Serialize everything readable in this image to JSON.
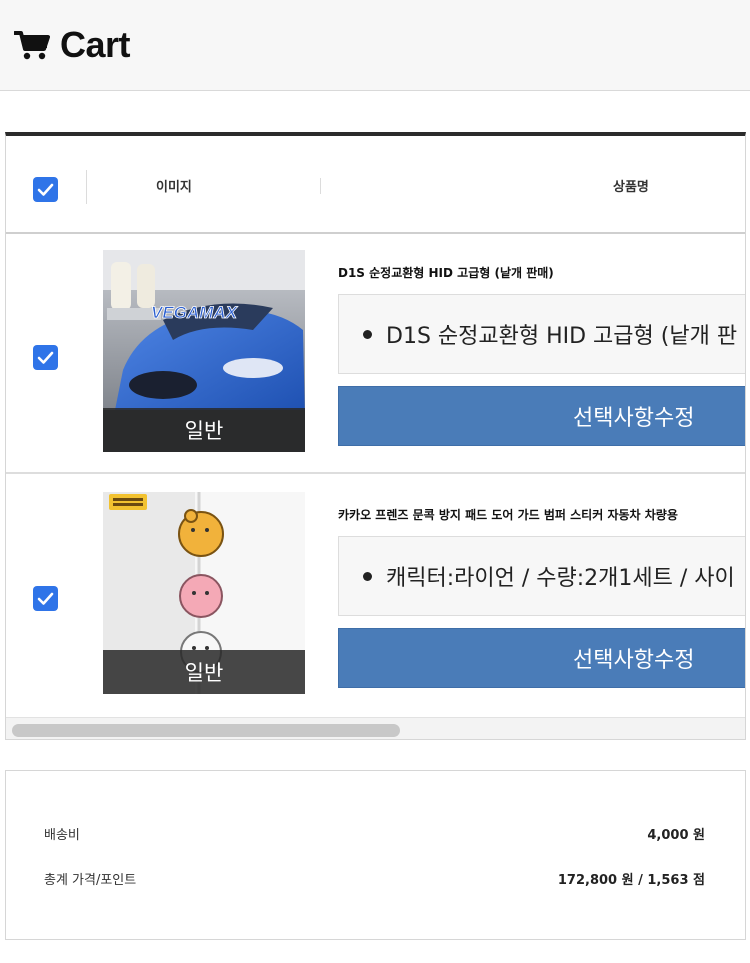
{
  "header": {
    "title": "Cart",
    "icon": "shopping-cart-icon"
  },
  "table": {
    "columns": [
      "이미지",
      "상품명"
    ],
    "select_all_checked": true,
    "items": [
      {
        "checked": true,
        "image": "car-hid-lamp-photo",
        "image_badge": "일반",
        "name": "D1S 순정교환형 HID 고급형 (낱개 판매)",
        "option": "D1S 순정교환형 HID 고급형 (낱개 판",
        "edit_label": "선택사항수정"
      },
      {
        "checked": true,
        "image": "kakao-friends-door-guard-photo",
        "image_badge": "일반",
        "name": "카카오 프렌즈 문콕 방지 패드 도어 가드 범퍼 스티커 자동차 차량용",
        "option": "캐릭터:라이언 / 수량:2개1세트 / 사이",
        "edit_label": "선택사항수정"
      }
    ]
  },
  "summary": {
    "shipping_label": "배송비",
    "shipping_value": "4,000 원",
    "total_label": "총계 가격/포인트",
    "total_value": "172,800 원 / 1,563 점"
  },
  "colors": {
    "checkbox": "#2f74e8",
    "edit_button": "#4a7cb8",
    "header_bg": "#f7f7f7"
  }
}
